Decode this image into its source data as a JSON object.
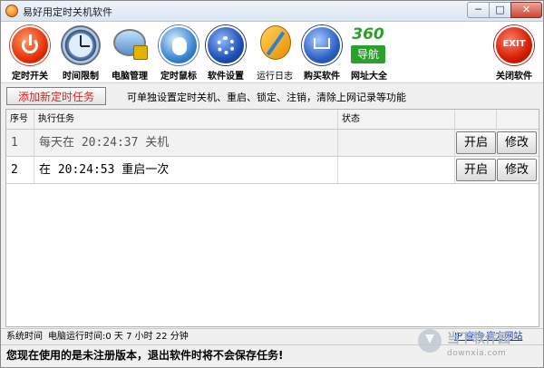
{
  "window": {
    "title": "易好用定时关机软件",
    "min_glyph": "─",
    "max_glyph": "□",
    "close_glyph": "✕"
  },
  "toolbar": [
    {
      "key": "timer",
      "label": "定时开关",
      "icon": "power-icon",
      "bold": true
    },
    {
      "key": "limit",
      "label": "时间限制",
      "icon": "clock-icon",
      "bold": true
    },
    {
      "key": "pc",
      "label": "电脑管理",
      "icon": "computer-lock-icon",
      "bold": true
    },
    {
      "key": "mouse",
      "label": "定时鼠标",
      "icon": "mouse-icon",
      "bold": true
    },
    {
      "key": "settings",
      "label": "软件设置",
      "icon": "gear-icon",
      "bold": true
    },
    {
      "key": "log",
      "label": "运行日志",
      "icon": "log-notebook-icon",
      "bold": false
    },
    {
      "key": "buy",
      "label": "购买软件",
      "icon": "cart-icon",
      "bold": true
    },
    {
      "key": "nav",
      "label": "网址大全",
      "icon": "360-nav-icon",
      "bold": true,
      "logo_top": "360",
      "logo_bottom": "导航"
    },
    {
      "key": "exit",
      "label": "关闭软件",
      "icon": "exit-icon",
      "bold": true,
      "logo_text": "EXIT"
    }
  ],
  "add_task": {
    "button_label": "添加新定时任务",
    "hint": "可单独设置定时关机、重启、锁定、注销，清除上网记录等功能"
  },
  "table": {
    "columns": [
      "序号",
      "执行任务",
      "状态",
      "",
      ""
    ],
    "rows": [
      {
        "index": "1",
        "task": "每天在 20:24:37 关机",
        "status": "",
        "start": "开启",
        "edit": "修改"
      },
      {
        "index": "2",
        "task": "在 20:24:53 重启一次",
        "status": "",
        "start": "开启",
        "edit": "修改"
      }
    ]
  },
  "status": {
    "system_time_label": "系统时间",
    "run_time": "电脑运行时间:0 天 7 小时 22 分钟",
    "ip_link": "IP 查询",
    "site_link": "官方网站",
    "warning": "您现在使用的是未注册版本，退出软件时将不会保存任务!"
  },
  "watermark": {
    "text": "当下软件园",
    "domain": "downxia.com"
  },
  "colors": {
    "accent_red": "#e81c1c",
    "link_blue": "#0a37c8",
    "nav_green": "#2aa12a"
  }
}
